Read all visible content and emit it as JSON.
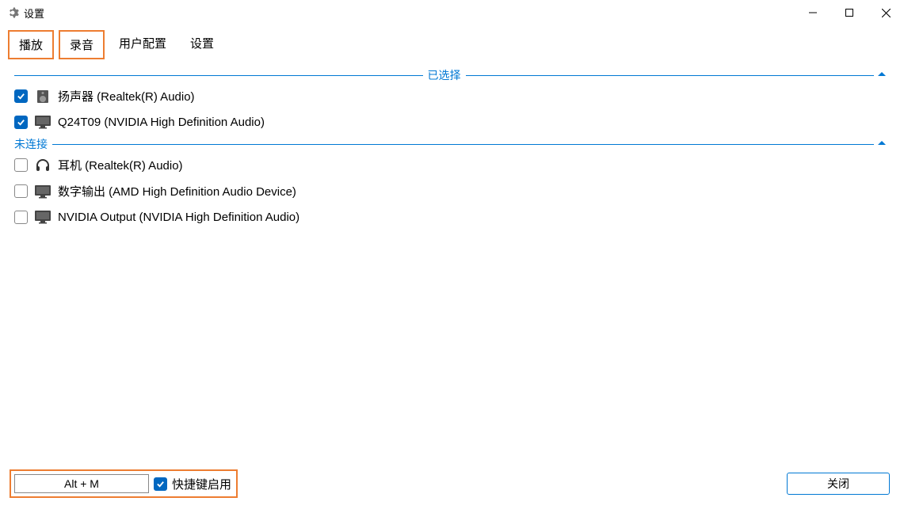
{
  "window": {
    "title": "设置"
  },
  "tabs": {
    "playback": "播放",
    "recording": "录音",
    "user_config": "用户配置",
    "settings": "设置"
  },
  "sections": {
    "selected": "已选择",
    "not_connected": "未连接"
  },
  "devices": {
    "selected": [
      {
        "label": "扬声器 (Realtek(R) Audio)",
        "checked": true,
        "icon": "speaker"
      },
      {
        "label": "Q24T09 (NVIDIA High Definition Audio)",
        "checked": true,
        "icon": "monitor"
      }
    ],
    "not_connected": [
      {
        "label": "耳机 (Realtek(R) Audio)",
        "checked": false,
        "icon": "headphones"
      },
      {
        "label": "数字输出 (AMD High Definition Audio Device)",
        "checked": false,
        "icon": "monitor"
      },
      {
        "label": "NVIDIA Output (NVIDIA High Definition Audio)",
        "checked": false,
        "icon": "monitor"
      }
    ]
  },
  "hotkey": {
    "value": "Alt + M",
    "enable_label": "快捷键启用",
    "enabled": true
  },
  "buttons": {
    "close": "关闭"
  }
}
